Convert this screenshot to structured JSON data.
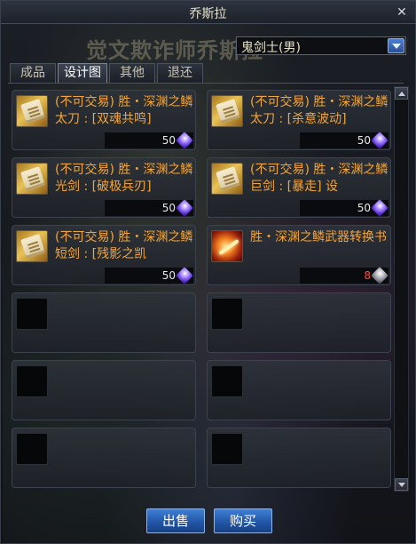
{
  "window": {
    "title": "乔斯拉"
  },
  "npc_title": "觉文欺诈师乔斯拉",
  "class_filter": {
    "selected": "鬼剑士(男)"
  },
  "tabs": [
    {
      "label": "成品",
      "active": false
    },
    {
      "label": "设计图",
      "active": true
    },
    {
      "label": "其他",
      "active": false
    },
    {
      "label": "退还",
      "active": false
    }
  ],
  "items": [
    {
      "name": "(不可交易) 胜・深渊之鳞太刀 : [双魂共鸣]",
      "icon": "blueprint-scroll-icon",
      "count": "50",
      "currency": "purple-crystal"
    },
    {
      "name": "(不可交易) 胜・深渊之鳞太刀 : [杀意波动]",
      "icon": "blueprint-scroll-icon",
      "count": "50",
      "currency": "purple-crystal"
    },
    {
      "name": "(不可交易) 胜・深渊之鳞光剑 : [破极兵刃]",
      "icon": "blueprint-scroll-icon",
      "count": "50",
      "currency": "purple-crystal"
    },
    {
      "name": "(不可交易) 胜・深渊之鳞巨剑 : [暴走] 设",
      "icon": "blueprint-scroll-icon",
      "count": "50",
      "currency": "purple-crystal"
    },
    {
      "name": "(不可交易) 胜・深渊之鳞短剑 : [残影之凯",
      "icon": "blueprint-scroll-icon",
      "count": "50",
      "currency": "purple-crystal"
    },
    {
      "name": "胜・深渊之鳞武器转换书",
      "icon": "conversion-book-icon",
      "count": "8",
      "currency": "grey-crystal",
      "count_insufficient": true
    }
  ],
  "empty_slots": 6,
  "buttons": {
    "sell": "出售",
    "buy": "购买"
  },
  "colors": {
    "item_name": "#f2a53a",
    "button_blue": "#2257a8",
    "insufficient": "#ff4a3a"
  }
}
